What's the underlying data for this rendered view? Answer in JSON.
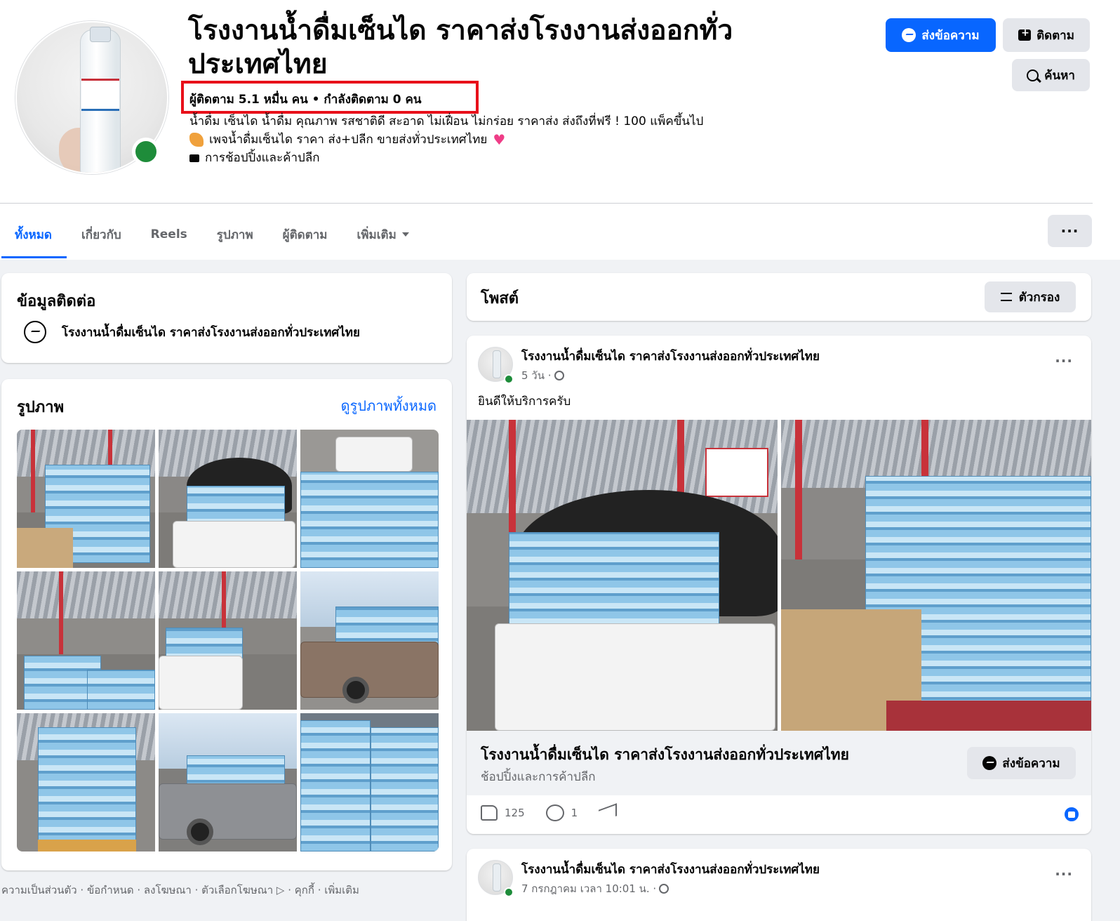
{
  "page": {
    "title": "โรงงานน้ำดื่มเซ็นได ราคาส่งโรงงานส่งออกทั่วประเทศไทย",
    "followers": "ผู้ติดตาม 5.1 หมื่น คน • กำลังติดตาม 0 คน",
    "description_line1": "น้ำดื่ม เซ็นได น้ำดื่ม คุณภาพ รสชาติดี สะอาด ไม่เฝื่อน ไม่กร่อย ราคาส่ง ส่งถึงที่ฟรี ! 100 แพ็คขึ้นไป",
    "description_line2": "เพจน้ำดื่มเซ็นได ราคา ส่ง+ปลีก ขายส่งทั่วประเทศไทย",
    "category": "การช้อปปิ้งและค้าปลีก"
  },
  "buttons": {
    "message": "ส่งข้อความ",
    "follow": "ติดตาม",
    "search": "ค้นหา",
    "more": "···",
    "filter": "ตัวกรอง"
  },
  "tabs": [
    {
      "label": "ทั้งหมด",
      "active": true
    },
    {
      "label": "เกี่ยวกับ",
      "active": false
    },
    {
      "label": "Reels",
      "active": false
    },
    {
      "label": "รูปภาพ",
      "active": false
    },
    {
      "label": "ผู้ติดตาม",
      "active": false
    },
    {
      "label": "เพิ่มเติม",
      "active": false
    }
  ],
  "contact": {
    "heading": "ข้อมูลติดต่อ",
    "messenger_name": "โรงงานน้ำดื่มเซ็นได ราคาส่งโรงงานส่งออกทั่วประเทศไทย"
  },
  "photos": {
    "heading": "รูปภาพ",
    "see_all": "ดูรูปภาพทั้งหมด"
  },
  "footer": {
    "links": "ความเป็นส่วนตัว · ข้อกำหนด · ลงโฆษณา · ตัวเลือกโฆษณา ▷ · คุกกี้ · เพิ่มเติม"
  },
  "posts": {
    "heading": "โพสต์",
    "items": [
      {
        "author": "โรงงานน้ำดื่มเซ็นได ราคาส่งโรงงานส่งออกทั่วประเทศไทย",
        "time": "5 วัน ·",
        "text": "ยินดีให้บริการครับ",
        "link_title": "โรงงานน้ำดื่มเซ็นได ราคาส่งโรงงานส่งออกทั่วประเทศไทย",
        "link_subtitle": "ช้อปปิ้งและการค้าปลีก",
        "link_button": "ส่งข้อความ",
        "likes": "125",
        "comments": "1"
      },
      {
        "author": "โรงงานน้ำดื่มเซ็นได ราคาส่งโรงงานส่งออกทั่วประเทศไทย",
        "time": "7 กรกฎาคม เวลา 10:01 น. ·"
      }
    ]
  },
  "colors": {
    "primary": "#0866ff",
    "highlight": "#e8101a",
    "online": "#1e8c3a"
  }
}
